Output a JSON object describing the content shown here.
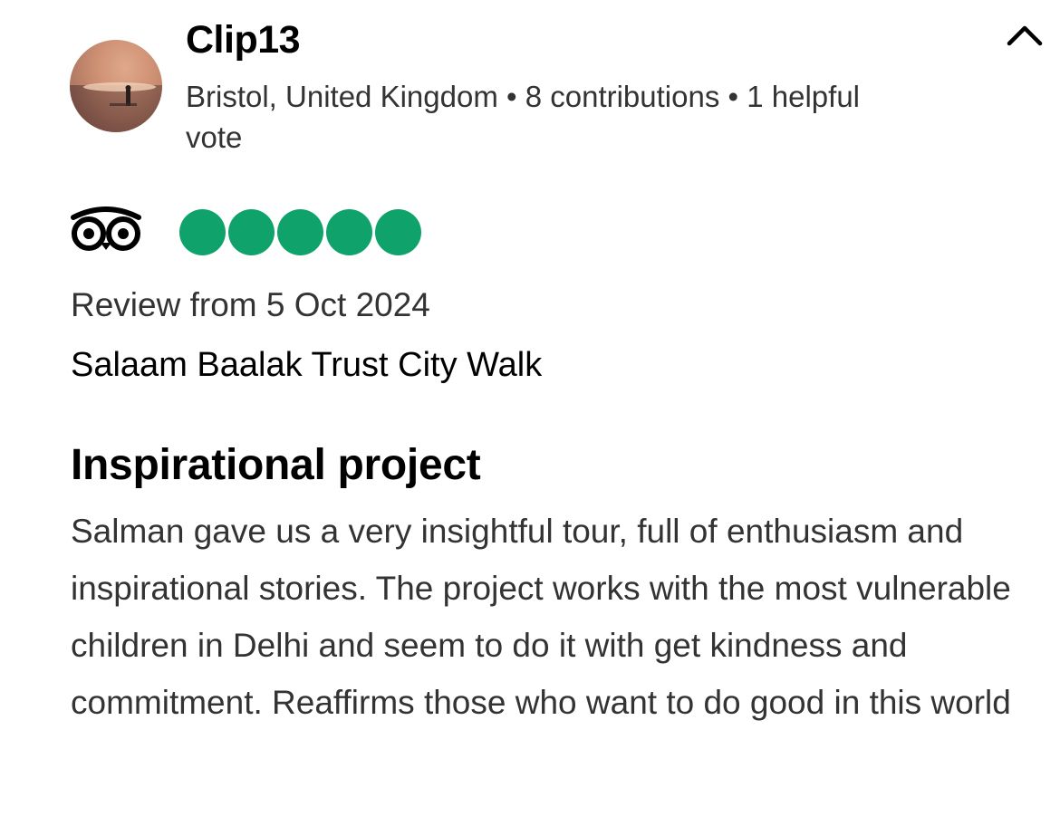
{
  "reviewer": {
    "name": "Clip13",
    "info": "Bristol, United Kingdom • 8 contributions • 1 helpful vote"
  },
  "icons": {
    "collapse": "chevron-up-icon",
    "logo": "tripadvisor-owl-icon"
  },
  "rating": {
    "value": 5,
    "max": 5,
    "color": "#0fa36b"
  },
  "review": {
    "date": "Review from 5 Oct 2024",
    "activity": "Salaam Baalak Trust City Walk",
    "title": "Inspirational project",
    "body": "Salman gave us a very insightful tour, full of enthusiasm and inspirational stories. The project works with the most vulnerable children in Delhi and seem to do it with get kindness and commitment. Reaffirms those who want to do good in this world"
  }
}
